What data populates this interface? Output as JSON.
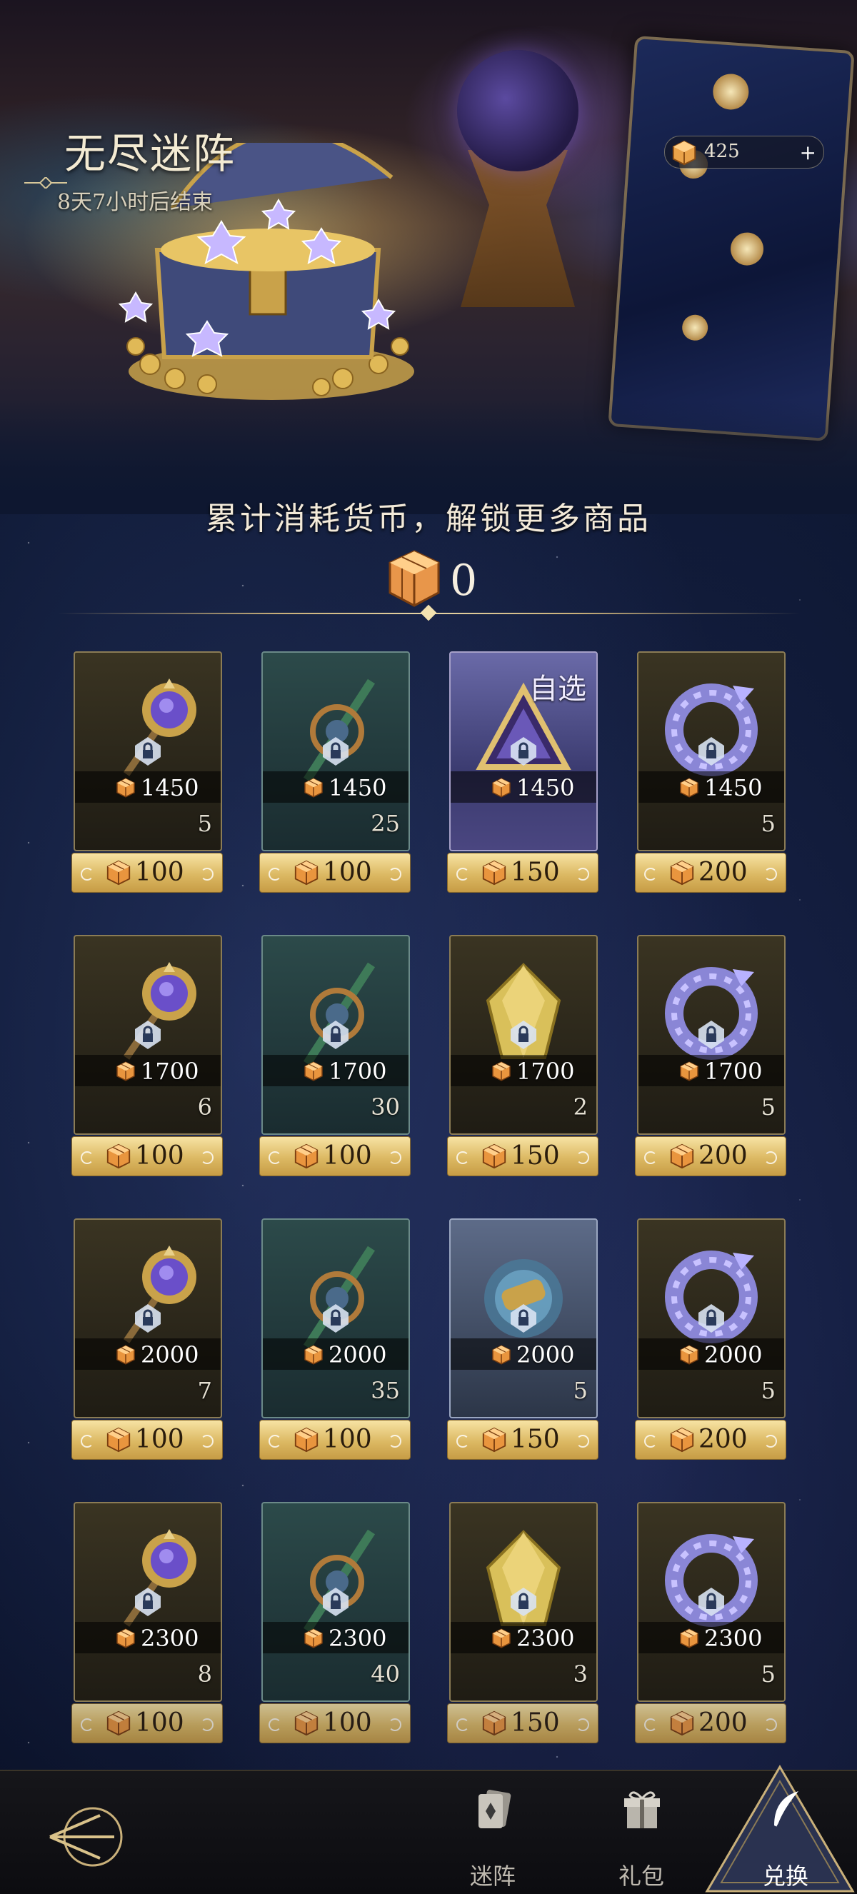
{
  "event": {
    "title": "无尽迷阵",
    "countdown": "8天7小时后结束"
  },
  "currency": {
    "balance": "425",
    "plus_symbol": "+"
  },
  "headline": "累计消耗货币，解锁更多商品",
  "spent": "0",
  "grid": [
    [
      {
        "card": "gold",
        "item": "key",
        "unlock": "1450",
        "count": "5",
        "price": "100",
        "tag": ""
      },
      {
        "card": "teal",
        "item": "staff",
        "unlock": "1450",
        "count": "25",
        "price": "100",
        "tag": ""
      },
      {
        "card": "purple",
        "item": "prism",
        "unlock": "1450",
        "count": "",
        "price": "150",
        "tag": "自选"
      },
      {
        "card": "gold",
        "item": "dragon",
        "unlock": "1450",
        "count": "5",
        "price": "200",
        "tag": ""
      }
    ],
    [
      {
        "card": "gold",
        "item": "key",
        "unlock": "1700",
        "count": "6",
        "price": "100",
        "tag": ""
      },
      {
        "card": "teal",
        "item": "staff",
        "unlock": "1700",
        "count": "30",
        "price": "100",
        "tag": ""
      },
      {
        "card": "gold",
        "item": "gem",
        "unlock": "1700",
        "count": "2",
        "price": "150",
        "tag": ""
      },
      {
        "card": "gold",
        "item": "dragon",
        "unlock": "1700",
        "count": "5",
        "price": "200",
        "tag": ""
      }
    ],
    [
      {
        "card": "gold",
        "item": "key",
        "unlock": "2000",
        "count": "7",
        "price": "100",
        "tag": ""
      },
      {
        "card": "teal",
        "item": "staff",
        "unlock": "2000",
        "count": "35",
        "price": "100",
        "tag": ""
      },
      {
        "card": "blue",
        "item": "orb",
        "unlock": "2000",
        "count": "5",
        "price": "150",
        "tag": ""
      },
      {
        "card": "gold",
        "item": "dragon",
        "unlock": "2000",
        "count": "5",
        "price": "200",
        "tag": ""
      }
    ],
    [
      {
        "card": "gold",
        "item": "key",
        "unlock": "2300",
        "count": "8",
        "price": "100",
        "tag": ""
      },
      {
        "card": "teal",
        "item": "staff",
        "unlock": "2300",
        "count": "40",
        "price": "100",
        "tag": ""
      },
      {
        "card": "gold",
        "item": "gem",
        "unlock": "2300",
        "count": "3",
        "price": "150",
        "tag": ""
      },
      {
        "card": "gold",
        "item": "dragon",
        "unlock": "2300",
        "count": "5",
        "price": "200",
        "tag": ""
      }
    ]
  ],
  "nav": {
    "back_icon": "back-arrow-icon",
    "tabs": [
      {
        "label": "迷阵",
        "icon": "cards-icon",
        "active": false
      },
      {
        "label": "礼包",
        "icon": "gift-icon",
        "active": false
      },
      {
        "label": "兑换",
        "icon": "feather-icon",
        "active": true
      }
    ]
  },
  "colors": {
    "gold": "#dcb963",
    "accent_text": "#f3ead2",
    "bg": "#0c1630"
  }
}
